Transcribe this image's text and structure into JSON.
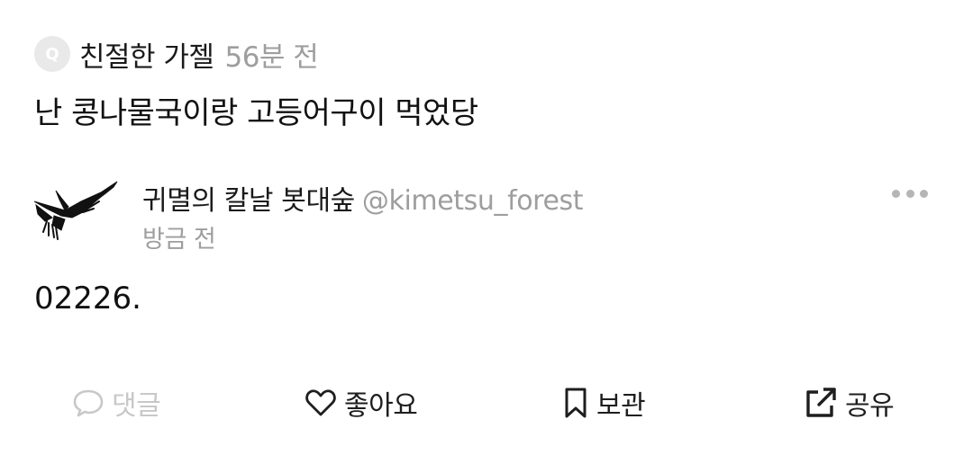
{
  "question": {
    "badge_letter": "Q",
    "author": "친절한 가젤",
    "time": "56분 전",
    "text": "난 콩나물국이랑 고등어구이 먹었당"
  },
  "answer": {
    "author_name": "귀멸의 칼날 봇대숲",
    "handle": "@kimetsu_forest",
    "time": "방금 전",
    "body": "02226.",
    "avatar_icon": "crow-icon",
    "more_icon": "more-horizontal-icon"
  },
  "actions": {
    "comment_label": "댓글",
    "like_label": "좋아요",
    "save_label": "보관",
    "share_label": "공유"
  },
  "colors": {
    "primary_text": "#111111",
    "secondary_text": "#9e9e9e",
    "disabled_action": "#c8c8c8",
    "badge_bg": "#e9e9e9"
  }
}
